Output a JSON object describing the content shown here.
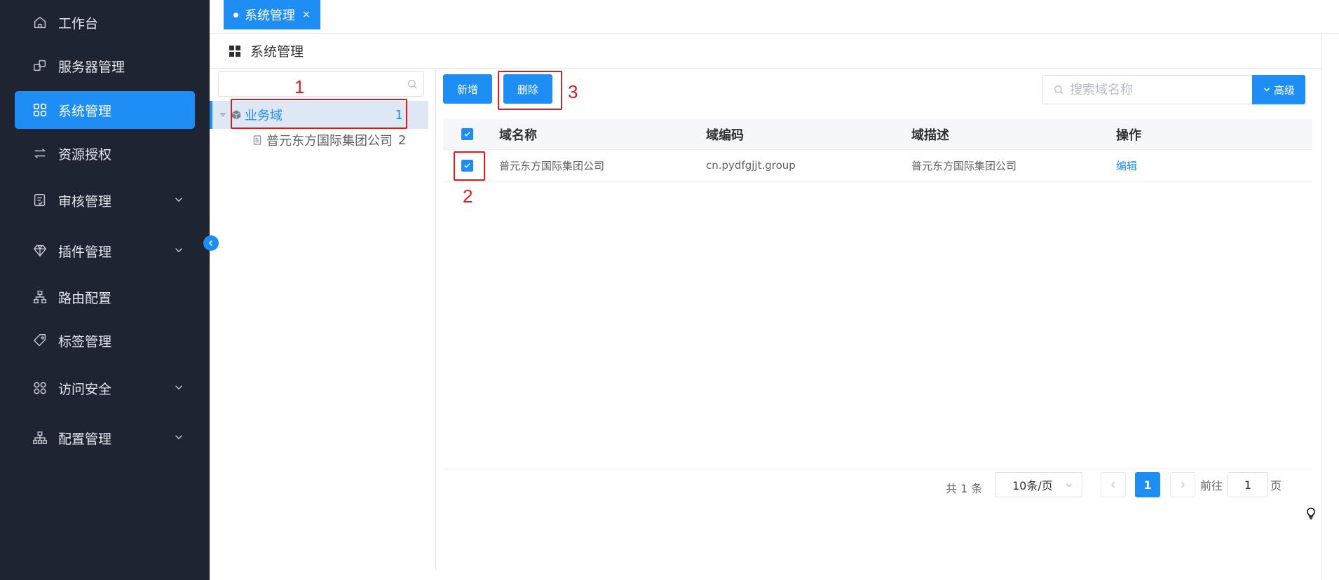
{
  "sidebar": {
    "items": [
      {
        "label": "工作台",
        "icon": "home-icon"
      },
      {
        "label": "服务器管理",
        "icon": "server-icon"
      },
      {
        "label": "系统管理",
        "icon": "apps-icon",
        "active": true
      },
      {
        "label": "资源授权",
        "icon": "transfer-icon"
      },
      {
        "label": "审核管理",
        "icon": "audit-icon",
        "expandable": true
      },
      {
        "label": "插件管理",
        "icon": "diamond-icon",
        "expandable": true
      },
      {
        "label": "路由配置",
        "icon": "route-icon"
      },
      {
        "label": "标签管理",
        "icon": "tag-icon"
      },
      {
        "label": "访问安全",
        "icon": "security-icon",
        "expandable": true
      },
      {
        "label": "配置管理",
        "icon": "org-chart-icon",
        "expandable": true
      }
    ]
  },
  "tabs": [
    {
      "label": "系统管理",
      "close": "×"
    }
  ],
  "page": {
    "title": "系统管理"
  },
  "tree": {
    "search_placeholder": "",
    "root": {
      "label": "业务域",
      "count": "1"
    },
    "children": [
      {
        "label": "普元东方国际集团公司",
        "count": "2"
      }
    ]
  },
  "toolbar": {
    "add_label": "新增",
    "delete_label": "删除",
    "search_placeholder": "搜索域名称",
    "advanced_label": "高级"
  },
  "table": {
    "columns": [
      "域名称",
      "域编码",
      "域描述",
      "操作"
    ],
    "rows": [
      {
        "name": "普元东方国际集团公司",
        "code": "cn.pydfgjjt.group",
        "desc": "普元东方国际集团公司",
        "action": "编辑",
        "checked": true
      }
    ]
  },
  "pagination": {
    "total_text": "共 1 条",
    "page_size": "10条/页",
    "current_page": "1",
    "goto_label": "前往",
    "goto_value": "1",
    "page_label": "页"
  },
  "annotations": {
    "n1": "1",
    "n2": "2",
    "n3": "3"
  },
  "colors": {
    "primary": "#1e8ef5",
    "sidebar_bg": "#1f2433",
    "annotation": "#e0191e"
  }
}
